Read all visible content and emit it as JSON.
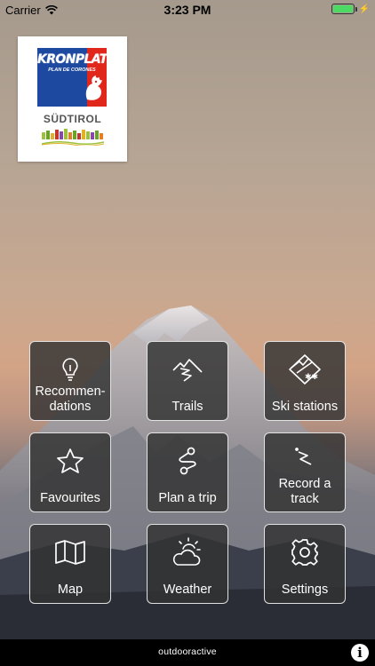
{
  "status_bar": {
    "carrier": "Carrier",
    "wifi_icon": "wifi-icon",
    "time": "3:23 PM",
    "battery_level": 1.0,
    "battery_color": "#4cd964"
  },
  "logo": {
    "brand": "KRONPLATZ",
    "subtitle": "PLAN DE CORONES",
    "region": "SÜDTIROL",
    "colors": {
      "blue": "#1d4aa0",
      "red": "#e1261c"
    }
  },
  "menu": {
    "tiles": [
      {
        "label": "Recommen-\ndations",
        "icon": "lightbulb-icon"
      },
      {
        "label": "Trails",
        "icon": "trail-mountain-icon"
      },
      {
        "label": "Ski stations",
        "icon": "ski-station-icon"
      },
      {
        "label": "Favourites",
        "icon": "star-icon"
      },
      {
        "label": "Plan a trip",
        "icon": "route-icon"
      },
      {
        "label": "Record a track",
        "icon": "record-track-icon"
      },
      {
        "label": "Map",
        "icon": "map-icon"
      },
      {
        "label": "Weather",
        "icon": "weather-icon"
      },
      {
        "label": "Settings",
        "icon": "gear-icon"
      }
    ]
  },
  "bottom_bar": {
    "brand": "outdooractive",
    "info_icon": "info-icon",
    "info_glyph": "i"
  }
}
